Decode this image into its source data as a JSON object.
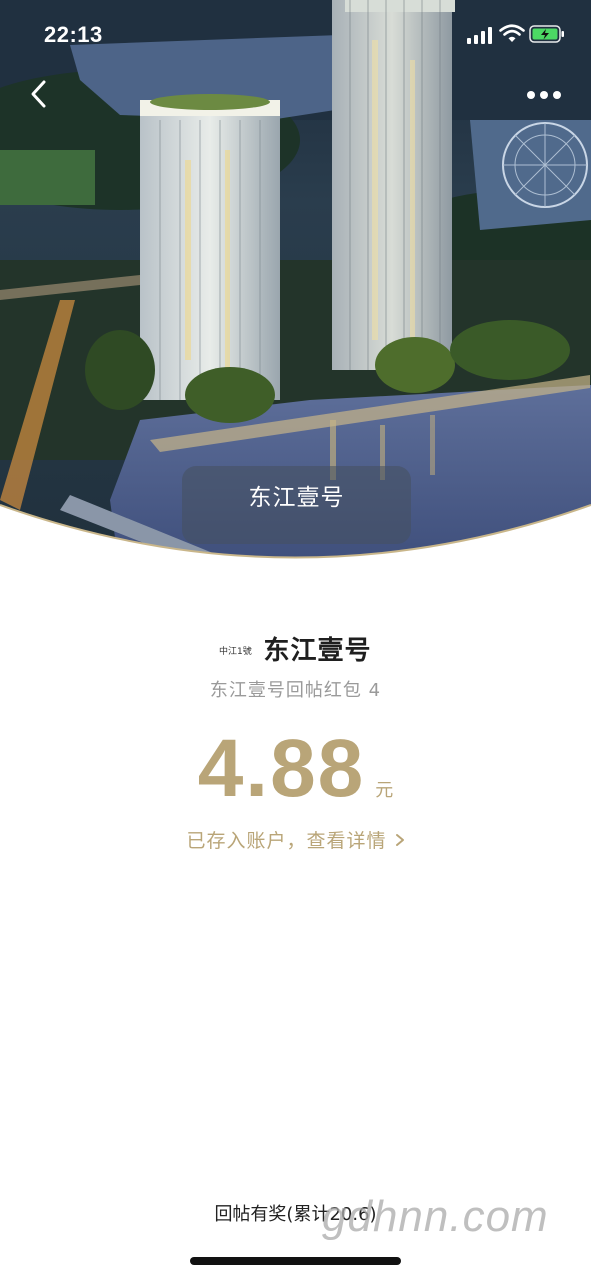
{
  "status_bar": {
    "time": "22:13"
  },
  "nav": {
    "back_icon": "chevron-left-icon",
    "more_icon": "more-dots-icon"
  },
  "hero": {
    "pill_label": "东江壹号"
  },
  "content": {
    "logo_text": "中江1號",
    "title": "东江壹号",
    "subtitle": "东江壹号回帖红包 4",
    "amount": "4.88",
    "unit": "元",
    "details_link": "已存入账户，查看详情"
  },
  "footer": {
    "text": "回帖有奖(累计20.6)"
  },
  "watermark": "gdhnn.com",
  "colors": {
    "accent_gold": "#b9a578",
    "subtitle_gray": "#9a9a9a",
    "pill_bg": "rgba(70,80,95,0.55)"
  }
}
